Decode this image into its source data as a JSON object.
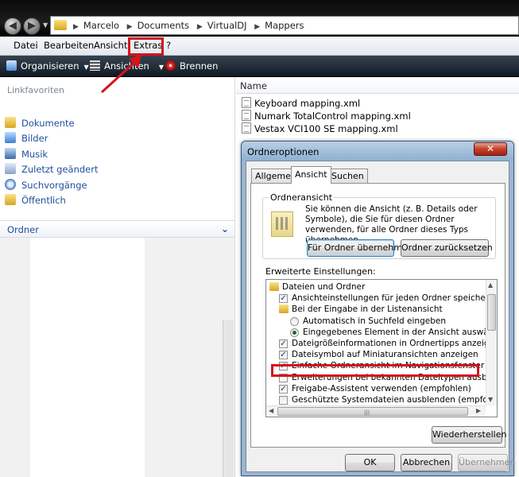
{
  "addressbar": {
    "crumbs": [
      "Marcelo",
      "Documents",
      "VirtualDJ",
      "Mappers"
    ]
  },
  "menubar": {
    "items": [
      "Datei",
      "Bearbeiten",
      "Ansicht",
      "Extras",
      "?"
    ]
  },
  "toolbar": {
    "organize": "Organisieren",
    "views": "Ansichten",
    "burn": "Brennen"
  },
  "navpane": {
    "header": "Linkfavoriten",
    "items": [
      {
        "label": "Dokumente",
        "icon": "folder-icon"
      },
      {
        "label": "Bilder",
        "icon": "pictures-icon"
      },
      {
        "label": "Musik",
        "icon": "music-icon"
      },
      {
        "label": "Zuletzt geändert",
        "icon": "recent-icon"
      },
      {
        "label": "Suchvorgänge",
        "icon": "search-icon"
      },
      {
        "label": "Öffentlich",
        "icon": "folder-icon"
      }
    ],
    "folders_label": "Ordner"
  },
  "filelist": {
    "column_name": "Name",
    "files": [
      "Keyboard mapping.xml",
      "Numark TotalControl mapping.xml",
      "Vestax VCI100 SE mapping.xml"
    ]
  },
  "dialog": {
    "title": "Ordneroptionen",
    "tabs": [
      "Allgemein",
      "Ansicht",
      "Suchen"
    ],
    "active_tab": "Ansicht",
    "group_label": "Ordneransicht",
    "group_text": "Sie können die Ansicht (z. B. Details oder Symbole), die Sie für diesen Ordner verwenden, für alle Ordner dieses Typs übernehmen.",
    "btn_apply_all": "Für Ordner übernehmen",
    "btn_reset": "Ordner zurücksetzen",
    "advanced_label": "Erweiterte Einstellungen:",
    "tree": [
      {
        "kind": "folder",
        "label": "Dateien und Ordner"
      },
      {
        "kind": "check",
        "checked": true,
        "label": "Ansichteinstellungen für jeden Ordner speichern"
      },
      {
        "kind": "folder",
        "label": "Bei der Eingabe in der Listenansicht"
      },
      {
        "kind": "radio",
        "checked": false,
        "label": "Automatisch in Suchfeld eingeben"
      },
      {
        "kind": "radio",
        "checked": true,
        "label": "Eingegebenes Element in der Ansicht auswählen"
      },
      {
        "kind": "check",
        "checked": true,
        "label": "Dateigrößeinformationen in Ordnertipps anzeigen"
      },
      {
        "kind": "check",
        "checked": true,
        "label": "Dateisymbol auf Miniaturansichten anzeigen"
      },
      {
        "kind": "check",
        "checked": true,
        "label": "Einfache Ordneransicht im Navigationsfenster anzeigen"
      },
      {
        "kind": "check",
        "checked": false,
        "label": "Erweiterungen bei bekannten Dateitypen ausblenden"
      },
      {
        "kind": "check",
        "checked": true,
        "label": "Freigabe-Assistent verwenden (empfohlen)"
      },
      {
        "kind": "check",
        "checked": false,
        "label": "Geschützte Systemdateien ausblenden (empfohlen)"
      }
    ],
    "btn_restore": "Wiederherstellen",
    "btn_ok": "OK",
    "btn_cancel": "Abbrechen",
    "btn_apply": "Übernehmen"
  },
  "colors": {
    "highlight": "#d3141c",
    "link": "#1f4e9c"
  }
}
